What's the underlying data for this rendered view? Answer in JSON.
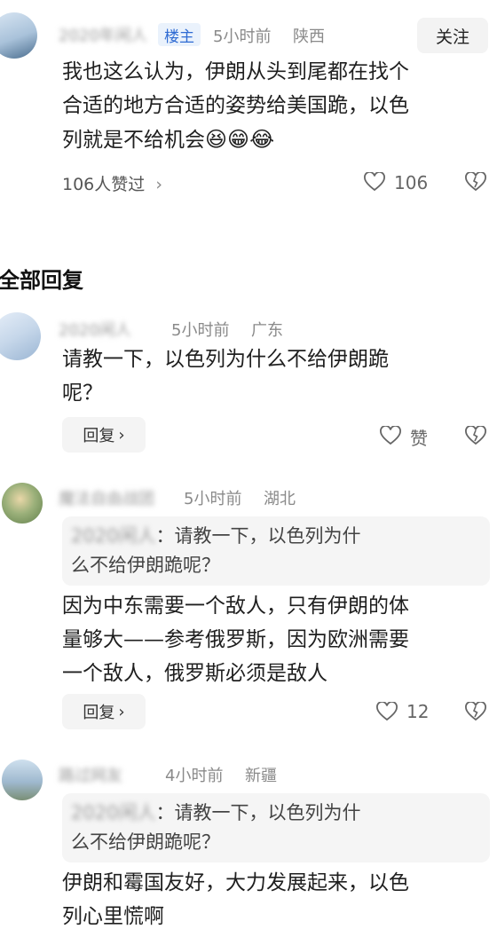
{
  "post": {
    "author_name": "2020年闲人",
    "badge": "楼主",
    "time": "5小时前",
    "location": "陕西",
    "follow_label": "关注",
    "text_lines": [
      "我也这么认为，伊朗从头到尾都在找个",
      "合适的地方合适的姿势给美国跪，以色",
      "列就是不给机会"
    ],
    "emojis": [
      "😆",
      "😁",
      "😂"
    ],
    "likes_summary": "106人赞过",
    "like_count": "106"
  },
  "section": {
    "title": "全部回复"
  },
  "replies": [
    {
      "author_name": "2020闲人",
      "time": "5小时前",
      "location": "广东",
      "text_lines": [
        "请教一下，以色列为什么不给伊朗跪",
        "呢？"
      ],
      "reply_label": "回复",
      "like_label": "赞"
    },
    {
      "author_name": "魔法自由战团",
      "time": "5小时前",
      "location": "湖北",
      "quote_name": "2020闲人",
      "quote_lines": [
        "：请教一下，以色列为什",
        "么不给伊朗跪呢？"
      ],
      "text_lines": [
        "因为中东需要一个敌人，只有伊朗的体",
        "量够大——参考俄罗斯，因为欧洲需要",
        "一个敌人，俄罗斯必须是敌人"
      ],
      "reply_label": "回复",
      "like_count": "12"
    },
    {
      "author_name": "路过网友",
      "time": "4小时前",
      "location": "新疆",
      "quote_name": "2020闲人",
      "quote_lines": [
        "：请教一下，以色列为什",
        "么不给伊朗跪呢？"
      ],
      "text_lines": [
        "伊朗和霉国友好，大力发展起来，以色",
        "列心里慌啊"
      ]
    }
  ]
}
